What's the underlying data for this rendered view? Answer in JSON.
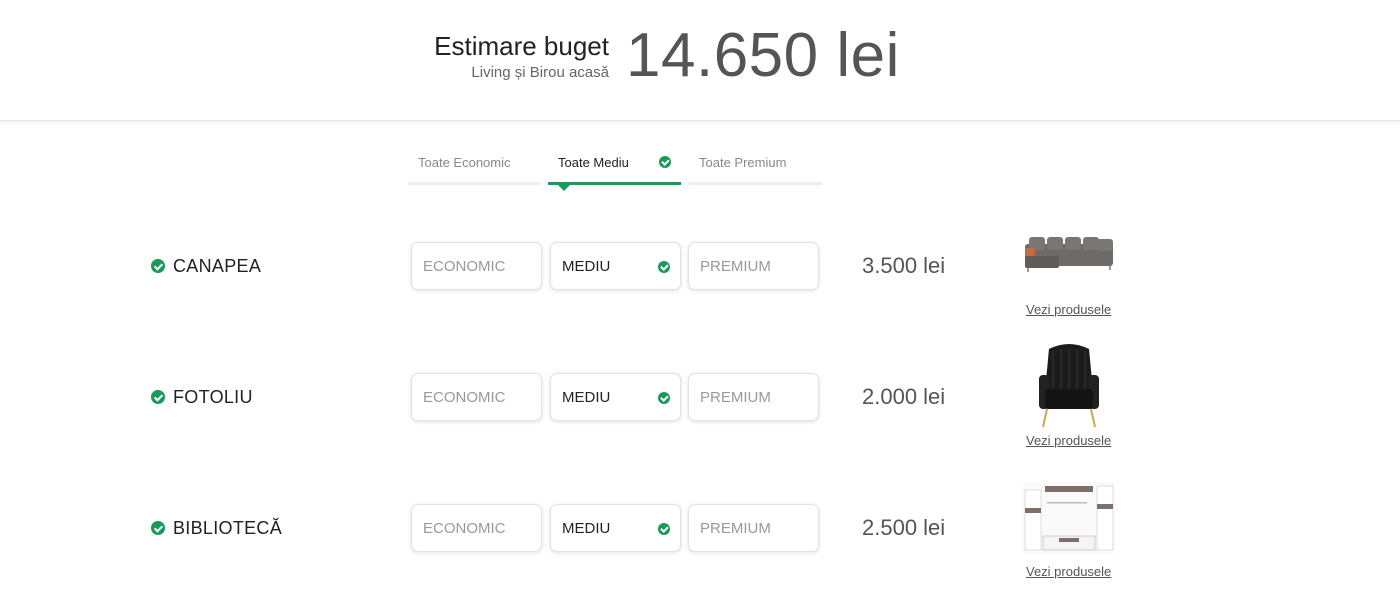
{
  "header": {
    "title": "Estimare buget",
    "subtitle": "Living și Birou acasă",
    "total": "14.650 lei"
  },
  "tabs": [
    {
      "label": "Toate Economic",
      "active": false
    },
    {
      "label": "Toate Mediu",
      "active": true
    },
    {
      "label": "Toate Premium",
      "active": false
    }
  ],
  "options": [
    "ECONOMIC",
    "MEDIU",
    "PREMIUM"
  ],
  "rows": [
    {
      "name": "CANAPEA",
      "selected": "MEDIU",
      "price": "3.500 lei",
      "link": "Vezi produsele",
      "image": "sofa-image"
    },
    {
      "name": "FOTOLIU",
      "selected": "MEDIU",
      "price": "2.000 lei",
      "link": "Vezi produsele",
      "image": "armchair-image"
    },
    {
      "name": "BIBLIOTECĂ",
      "selected": "MEDIU",
      "price": "2.500 lei",
      "link": "Vezi produsele",
      "image": "bookcase-image"
    }
  ],
  "colors": {
    "accent": "#1a9a5a",
    "text": "#222222",
    "muted": "#999999"
  }
}
